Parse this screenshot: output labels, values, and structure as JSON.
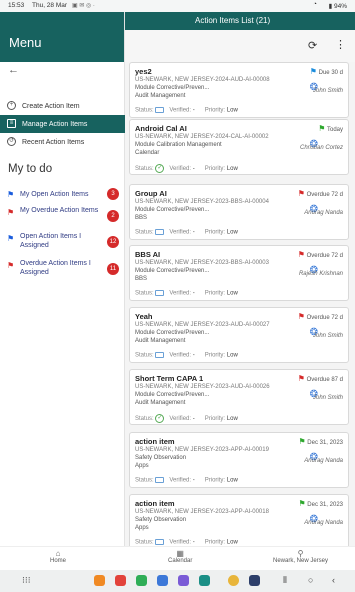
{
  "status_bar": {
    "time": "15:53",
    "date": "Thu, 28 Mar",
    "battery": "94%"
  },
  "menu": {
    "title": "Menu",
    "items": [
      {
        "label": "Create Action Item",
        "active": false
      },
      {
        "label": "Manage Action Items",
        "active": true
      },
      {
        "label": "Recent Action Items",
        "active": false
      }
    ],
    "todo_title": "My to do",
    "todos": [
      {
        "label": "My Open Action Items",
        "count": "3",
        "flag_color": "#1a5cdc"
      },
      {
        "label": "My Overdue Action Items",
        "count": "2",
        "flag_color": "#d52a2a"
      },
      {
        "label": "Open Action Items I Assigned",
        "count": "12",
        "flag_color": "#1a5cdc"
      },
      {
        "label": "Overdue Action Items I Assigned",
        "count": "11",
        "flag_color": "#d52a2a"
      }
    ]
  },
  "header": {
    "title": "Action Items List (21)"
  },
  "labels": {
    "status": "Status:",
    "verified": "Verified:",
    "priority": "Priority:"
  },
  "cards": [
    {
      "title": "yes2",
      "id": "US-NEWARK, NEW JERSEY-2024-AUD-AI-00008",
      "module": "Module Corrective/Preven...",
      "category": "Audit Management",
      "due": "Due 30 d",
      "flag_color": "#1a8cdc",
      "owner": "John Smith",
      "verified": "-",
      "priority": "Low",
      "status_done": false
    },
    {
      "title": "Android Cal AI",
      "id": "US-NEWARK, NEW JERSEY-2024-CAL-AI-00002",
      "module": "Module Calibration Management",
      "category": "Calendar",
      "due": "Today",
      "flag_color": "#2ea82e",
      "owner": "Christian Cortez",
      "verified": "-",
      "priority": "Low",
      "status_done": true
    },
    {
      "title": "Group AI",
      "id": "US-NEWARK, NEW JERSEY-2023-BBS-AI-00004",
      "module": "Module Corrective/Preven...",
      "category": "BBS",
      "due": "Overdue 72 d",
      "flag_color": "#d52a2a",
      "owner": "Anurag Nanda",
      "verified": "-",
      "priority": "Low",
      "status_done": false
    },
    {
      "title": "BBS AI",
      "id": "US-NEWARK, NEW JERSEY-2023-BBS-AI-00003",
      "module": "Module Corrective/Preven...",
      "category": "BBS",
      "due": "Overdue 72 d",
      "flag_color": "#d52a2a",
      "owner": "Rajesh Krishnan",
      "verified": "-",
      "priority": "Low",
      "status_done": false
    },
    {
      "title": "Yeah",
      "id": "US-NEWARK, NEW JERSEY-2023-AUD-AI-00027",
      "module": "Module Corrective/Preven...",
      "category": "Audit Management",
      "due": "Overdue 72 d",
      "flag_color": "#d52a2a",
      "owner": "John Smith",
      "verified": "-",
      "priority": "Low",
      "status_done": false
    },
    {
      "title": "Short Term CAPA 1",
      "id": "US-NEWARK, NEW JERSEY-2023-AUD-AI-00026",
      "module": "Module Corrective/Preven...",
      "category": "Audit Management",
      "due": "Overdue 87 d",
      "flag_color": "#d52a2a",
      "owner": "John Smith",
      "verified": "-",
      "priority": "Low",
      "status_done": true
    },
    {
      "title": "action item",
      "id": "US-NEWARK, NEW JERSEY-2023-APP-AI-00019",
      "module": "Safety Observation",
      "category": "Apps",
      "due": "Dec 31, 2023",
      "flag_color": "#2ea82e",
      "owner": "Anurag Nanda",
      "verified": "-",
      "priority": "Low",
      "status_done": false
    },
    {
      "title": "action item",
      "id": "US-NEWARK, NEW JERSEY-2023-APP-AI-00018",
      "module": "Safety Observation",
      "category": "Apps",
      "due": "Dec 31, 2023",
      "flag_color": "#2ea82e",
      "owner": "Anurag Nanda",
      "verified": "-",
      "priority": "Low",
      "status_done": false
    }
  ],
  "bottom_nav": {
    "home": "Home",
    "calendar": "Calendar",
    "location": "Newark, New Jersey"
  },
  "colors": {
    "primary": "#17625f",
    "badge": "#d52a2a"
  }
}
